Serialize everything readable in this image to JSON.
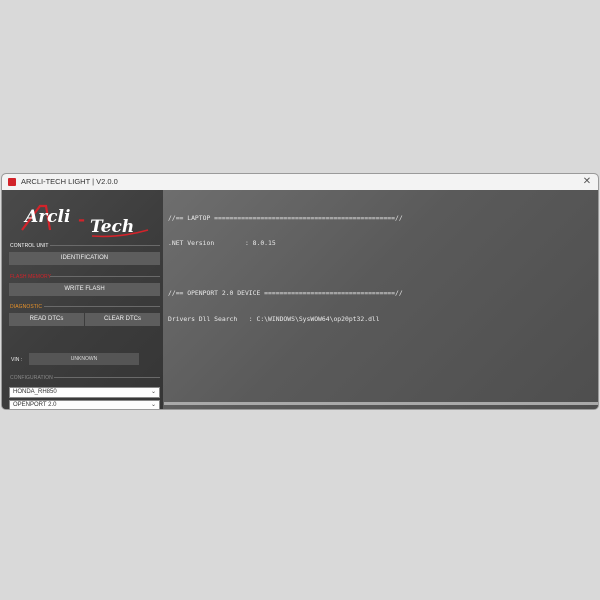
{
  "window": {
    "title": "ARCLI-TECH LIGHT | V2.0.0",
    "close_glyph": "✕",
    "app_icon": "app-icon"
  },
  "logo": {
    "part1": "Arcli",
    "part2": "Tech",
    "dash": "-",
    "colors": {
      "primary": "#ffffff",
      "accent": "#d2232a"
    }
  },
  "sidebar": {
    "control_unit": {
      "label": "CONTROL UNIT",
      "color": "#ffffff",
      "button": "IDENTIFICATION"
    },
    "flash_memory": {
      "label": "FLASH MEMORY",
      "color": "#d2232a",
      "button": "WRITE FLASH"
    },
    "diagnostic": {
      "label": "DIAGNOSTIC",
      "color": "#e8922a",
      "buttons": [
        "READ DTCs",
        "CLEAR DTCs"
      ]
    },
    "vin": {
      "label": "VIN :",
      "value": "UNKNOWN"
    },
    "configuration": {
      "label": "CONFIGURATION",
      "color": "#8a8a8a",
      "ecu_select": "HONDA_RH850",
      "interface_select": "OPENPORT 2.0"
    }
  },
  "console": {
    "lines": [
      "//== LAPTOP ===============================================//",
      ".NET Version        : 8.0.15",
      "",
      "//== OPENPORT 2.0 DEVICE ==================================//",
      "Drivers Dll Search   : C:\\WINDOWS\\SysWOW64\\op20pt32.dll"
    ]
  }
}
